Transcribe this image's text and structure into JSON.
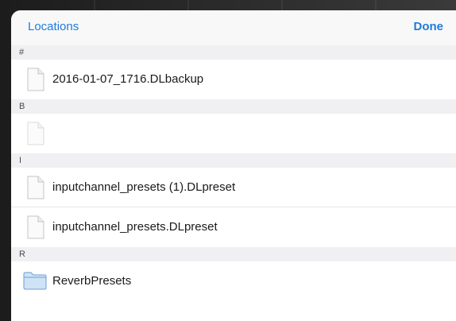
{
  "navbar": {
    "left_label": "Locations",
    "right_label": "Done"
  },
  "sections": [
    {
      "header": "#",
      "items": [
        {
          "label": "2016-01-07_1716.DLbackup",
          "icon": "file-icon"
        }
      ]
    },
    {
      "header": "B",
      "items": [
        {
          "label": "",
          "icon": "file-icon",
          "disabled": true
        }
      ]
    },
    {
      "header": "I",
      "items": [
        {
          "label": "inputchannel_presets (1).DLpreset",
          "icon": "file-icon"
        },
        {
          "label": "inputchannel_presets.DLpreset",
          "icon": "file-icon"
        }
      ]
    },
    {
      "header": "R",
      "items": [
        {
          "label": "ReverbPresets",
          "icon": "folder-icon"
        }
      ]
    }
  ],
  "colors": {
    "accent": "#1f7bd8",
    "section_bg": "#f0f0f3",
    "navbar_bg": "#f8f8f8"
  }
}
